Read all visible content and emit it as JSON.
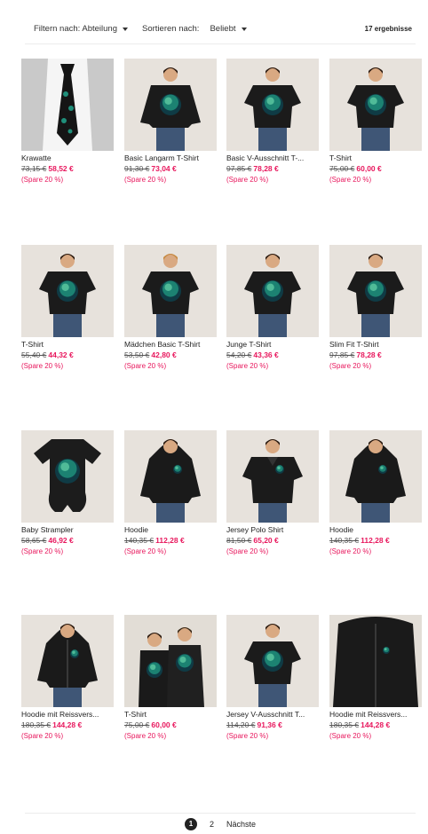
{
  "toolbar": {
    "filter_label": "Filtern nach: Abteilung",
    "sort_label": "Sortieren nach:",
    "sort_value": "Beliebt",
    "results_count": "17 ergebnisse"
  },
  "products": [
    {
      "name": "Krawatte",
      "old_price": "73,15 €",
      "new_price": "58,52 €",
      "save": "(Spare 20 %)",
      "type": "tie"
    },
    {
      "name": "Basic Langarm T-Shirt",
      "old_price": "91,30 €",
      "new_price": "73,04 €",
      "save": "(Spare 20 %)",
      "type": "longsleeve"
    },
    {
      "name": "Basic V-Ausschnitt T-...",
      "old_price": "97,85 €",
      "new_price": "78,28 €",
      "save": "(Spare 20 %)",
      "type": "tee-f"
    },
    {
      "name": "T-Shirt",
      "old_price": "75,00 €",
      "new_price": "60,00 €",
      "save": "(Spare 20 %)",
      "type": "tee-f"
    },
    {
      "name": "T-Shirt",
      "old_price": "55,40 €",
      "new_price": "44,32 €",
      "save": "(Spare 20 %)",
      "type": "tee-m"
    },
    {
      "name": "Mädchen Basic T-Shirt",
      "old_price": "53,50 €",
      "new_price": "42,80 €",
      "save": "(Spare 20 %)",
      "type": "tee-girl"
    },
    {
      "name": "Junge T-Shirt",
      "old_price": "54,20 €",
      "new_price": "43,36 €",
      "save": "(Spare 20 %)",
      "type": "tee-m"
    },
    {
      "name": "Slim Fit T-Shirt",
      "old_price": "97,85 €",
      "new_price": "78,28 €",
      "save": "(Spare 20 %)",
      "type": "tee-f"
    },
    {
      "name": "Baby Strampler",
      "old_price": "58,65 €",
      "new_price": "46,92 €",
      "save": "(Spare 20 %)",
      "type": "onesie"
    },
    {
      "name": "Hoodie",
      "old_price": "140,35 €",
      "new_price": "112,28 €",
      "save": "(Spare 20 %)",
      "type": "hoodie"
    },
    {
      "name": "Jersey Polo Shirt",
      "old_price": "81,50 €",
      "new_price": "65,20 €",
      "save": "(Spare 20 %)",
      "type": "polo"
    },
    {
      "name": "Hoodie",
      "old_price": "140,35 €",
      "new_price": "112,28 €",
      "save": "(Spare 20 %)",
      "type": "hoodie"
    },
    {
      "name": "Hoodie mit Reissvers...",
      "old_price": "180,35 €",
      "new_price": "144,28 €",
      "save": "(Spare 20 %)",
      "type": "zip"
    },
    {
      "name": "T-Shirt",
      "old_price": "75,00 €",
      "new_price": "60,00 €",
      "save": "(Spare 20 %)",
      "type": "couple"
    },
    {
      "name": "Jersey V-Ausschnitt T...",
      "old_price": "114,20 €",
      "new_price": "91,36 €",
      "save": "(Spare 20 %)",
      "type": "tee-f"
    },
    {
      "name": "Hoodie mit Reissvers...",
      "old_price": "180,35 €",
      "new_price": "144,28 €",
      "save": "(Spare 20 %)",
      "type": "zip-closeup"
    }
  ],
  "pagination": {
    "current": "1",
    "next_page": "2",
    "next_label": "Nächste"
  }
}
